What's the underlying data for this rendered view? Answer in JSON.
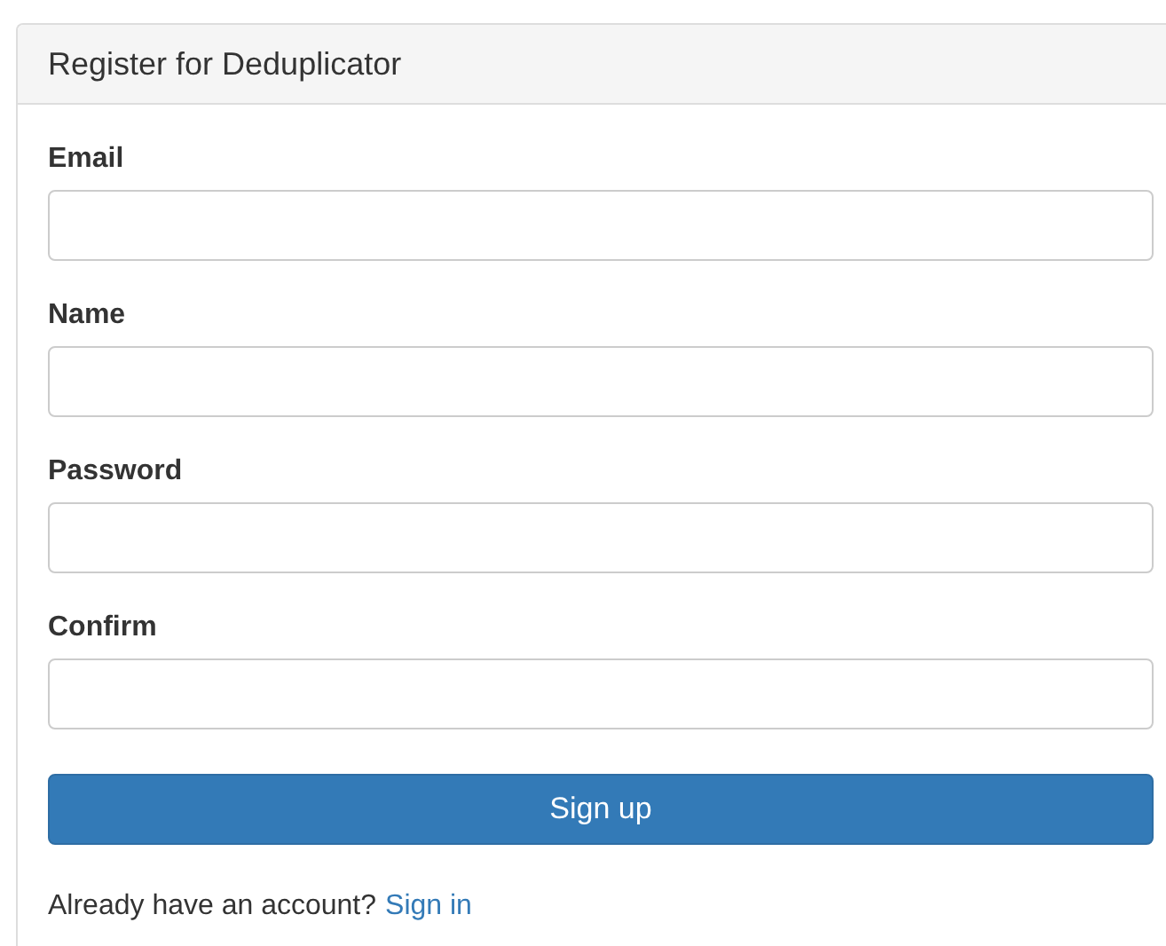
{
  "panel": {
    "title": "Register for Deduplicator"
  },
  "fields": [
    {
      "label": "Email"
    },
    {
      "label": "Name"
    },
    {
      "label": "Password"
    },
    {
      "label": "Confirm"
    }
  ],
  "submit_button": "Sign up",
  "footer": {
    "text": "Already have an account?",
    "link": "Sign in"
  }
}
